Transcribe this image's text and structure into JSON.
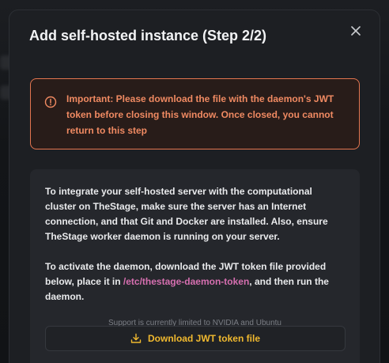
{
  "modal": {
    "title": "Add self-hosted instance (Step 2/2)",
    "close_icon": "close-icon"
  },
  "alert": {
    "icon": "warning-circle-icon",
    "text": "Important: Please download the file with the daemon's JWT token before closing this window. Once closed, you cannot return to this step",
    "color": "#f08a62"
  },
  "info": {
    "paragraph1": "To integrate your self-hosted server with the computational cluster on TheStage, make sure the server has an Internet connection, and that Git and Docker are installed. Also, ensure TheStage worker daemon is running on your server.",
    "paragraph2_before": "To activate the daemon, download the JWT token file provided below, place it in ",
    "paragraph2_path": "/etc/thestage-daemon-token",
    "paragraph2_after": ", and then run the daemon.",
    "support_note": "Support is currently limited to NVIDIA and Ubuntu",
    "download_label": "Download JWT token file",
    "download_icon": "download-icon",
    "accent": "#f0b92f",
    "path_color": "#d66fb0"
  }
}
